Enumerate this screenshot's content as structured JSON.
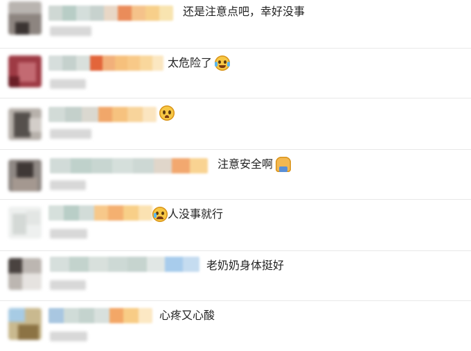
{
  "comments": [
    {
      "text": "还是注意点吧，幸好没事",
      "emoji": ""
    },
    {
      "text": "太危险了",
      "emoji": "crying-laughing-emoji-icon"
    },
    {
      "text": "",
      "emoji": "pleading-face-emoji-icon"
    },
    {
      "text": "注意安全啊",
      "emoji": "person-emoji-icon"
    },
    {
      "text": "人没事就行",
      "emoji": "crying-face-emoji-icon"
    },
    {
      "text": "老奶奶身体挺好",
      "emoji": ""
    },
    {
      "text": "心疼又心酸",
      "emoji": ""
    }
  ],
  "colors": {
    "text": "#222222",
    "divider": "#e8e8e8",
    "background": "#ffffff"
  }
}
